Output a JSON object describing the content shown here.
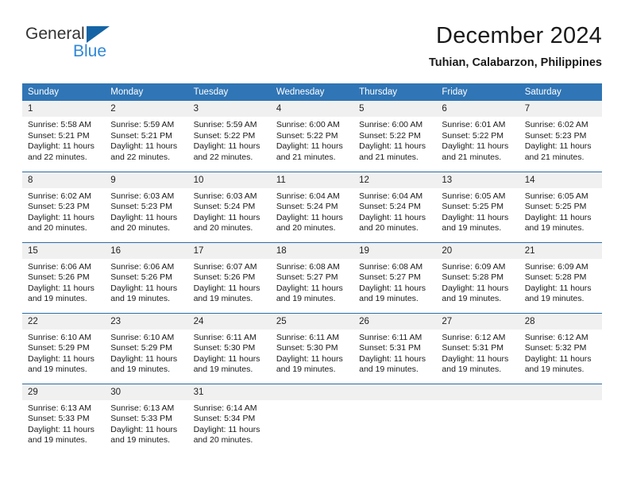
{
  "brand": {
    "name_top": "General",
    "name_bottom": "Blue",
    "triangle_color": "#1464a5",
    "blue_text_color": "#2f87d8"
  },
  "header": {
    "title": "December 2024",
    "subtitle": "Tuhian, Calabarzon, Philippines",
    "accent_color": "#3075b5",
    "row_divider_color": "#2e6da4",
    "daynum_bg": "#f0f0f0"
  },
  "weekday_headers": [
    "Sunday",
    "Monday",
    "Tuesday",
    "Wednesday",
    "Thursday",
    "Friday",
    "Saturday"
  ],
  "weeks": [
    [
      {
        "day": "1",
        "sunrise": "Sunrise: 5:58 AM",
        "sunset": "Sunset: 5:21 PM",
        "daylight_line1": "Daylight: 11 hours",
        "daylight_line2": "and 22 minutes."
      },
      {
        "day": "2",
        "sunrise": "Sunrise: 5:59 AM",
        "sunset": "Sunset: 5:21 PM",
        "daylight_line1": "Daylight: 11 hours",
        "daylight_line2": "and 22 minutes."
      },
      {
        "day": "3",
        "sunrise": "Sunrise: 5:59 AM",
        "sunset": "Sunset: 5:22 PM",
        "daylight_line1": "Daylight: 11 hours",
        "daylight_line2": "and 22 minutes."
      },
      {
        "day": "4",
        "sunrise": "Sunrise: 6:00 AM",
        "sunset": "Sunset: 5:22 PM",
        "daylight_line1": "Daylight: 11 hours",
        "daylight_line2": "and 21 minutes."
      },
      {
        "day": "5",
        "sunrise": "Sunrise: 6:00 AM",
        "sunset": "Sunset: 5:22 PM",
        "daylight_line1": "Daylight: 11 hours",
        "daylight_line2": "and 21 minutes."
      },
      {
        "day": "6",
        "sunrise": "Sunrise: 6:01 AM",
        "sunset": "Sunset: 5:22 PM",
        "daylight_line1": "Daylight: 11 hours",
        "daylight_line2": "and 21 minutes."
      },
      {
        "day": "7",
        "sunrise": "Sunrise: 6:02 AM",
        "sunset": "Sunset: 5:23 PM",
        "daylight_line1": "Daylight: 11 hours",
        "daylight_line2": "and 21 minutes."
      }
    ],
    [
      {
        "day": "8",
        "sunrise": "Sunrise: 6:02 AM",
        "sunset": "Sunset: 5:23 PM",
        "daylight_line1": "Daylight: 11 hours",
        "daylight_line2": "and 20 minutes."
      },
      {
        "day": "9",
        "sunrise": "Sunrise: 6:03 AM",
        "sunset": "Sunset: 5:23 PM",
        "daylight_line1": "Daylight: 11 hours",
        "daylight_line2": "and 20 minutes."
      },
      {
        "day": "10",
        "sunrise": "Sunrise: 6:03 AM",
        "sunset": "Sunset: 5:24 PM",
        "daylight_line1": "Daylight: 11 hours",
        "daylight_line2": "and 20 minutes."
      },
      {
        "day": "11",
        "sunrise": "Sunrise: 6:04 AM",
        "sunset": "Sunset: 5:24 PM",
        "daylight_line1": "Daylight: 11 hours",
        "daylight_line2": "and 20 minutes."
      },
      {
        "day": "12",
        "sunrise": "Sunrise: 6:04 AM",
        "sunset": "Sunset: 5:24 PM",
        "daylight_line1": "Daylight: 11 hours",
        "daylight_line2": "and 20 minutes."
      },
      {
        "day": "13",
        "sunrise": "Sunrise: 6:05 AM",
        "sunset": "Sunset: 5:25 PM",
        "daylight_line1": "Daylight: 11 hours",
        "daylight_line2": "and 19 minutes."
      },
      {
        "day": "14",
        "sunrise": "Sunrise: 6:05 AM",
        "sunset": "Sunset: 5:25 PM",
        "daylight_line1": "Daylight: 11 hours",
        "daylight_line2": "and 19 minutes."
      }
    ],
    [
      {
        "day": "15",
        "sunrise": "Sunrise: 6:06 AM",
        "sunset": "Sunset: 5:26 PM",
        "daylight_line1": "Daylight: 11 hours",
        "daylight_line2": "and 19 minutes."
      },
      {
        "day": "16",
        "sunrise": "Sunrise: 6:06 AM",
        "sunset": "Sunset: 5:26 PM",
        "daylight_line1": "Daylight: 11 hours",
        "daylight_line2": "and 19 minutes."
      },
      {
        "day": "17",
        "sunrise": "Sunrise: 6:07 AM",
        "sunset": "Sunset: 5:26 PM",
        "daylight_line1": "Daylight: 11 hours",
        "daylight_line2": "and 19 minutes."
      },
      {
        "day": "18",
        "sunrise": "Sunrise: 6:08 AM",
        "sunset": "Sunset: 5:27 PM",
        "daylight_line1": "Daylight: 11 hours",
        "daylight_line2": "and 19 minutes."
      },
      {
        "day": "19",
        "sunrise": "Sunrise: 6:08 AM",
        "sunset": "Sunset: 5:27 PM",
        "daylight_line1": "Daylight: 11 hours",
        "daylight_line2": "and 19 minutes."
      },
      {
        "day": "20",
        "sunrise": "Sunrise: 6:09 AM",
        "sunset": "Sunset: 5:28 PM",
        "daylight_line1": "Daylight: 11 hours",
        "daylight_line2": "and 19 minutes."
      },
      {
        "day": "21",
        "sunrise": "Sunrise: 6:09 AM",
        "sunset": "Sunset: 5:28 PM",
        "daylight_line1": "Daylight: 11 hours",
        "daylight_line2": "and 19 minutes."
      }
    ],
    [
      {
        "day": "22",
        "sunrise": "Sunrise: 6:10 AM",
        "sunset": "Sunset: 5:29 PM",
        "daylight_line1": "Daylight: 11 hours",
        "daylight_line2": "and 19 minutes."
      },
      {
        "day": "23",
        "sunrise": "Sunrise: 6:10 AM",
        "sunset": "Sunset: 5:29 PM",
        "daylight_line1": "Daylight: 11 hours",
        "daylight_line2": "and 19 minutes."
      },
      {
        "day": "24",
        "sunrise": "Sunrise: 6:11 AM",
        "sunset": "Sunset: 5:30 PM",
        "daylight_line1": "Daylight: 11 hours",
        "daylight_line2": "and 19 minutes."
      },
      {
        "day": "25",
        "sunrise": "Sunrise: 6:11 AM",
        "sunset": "Sunset: 5:30 PM",
        "daylight_line1": "Daylight: 11 hours",
        "daylight_line2": "and 19 minutes."
      },
      {
        "day": "26",
        "sunrise": "Sunrise: 6:11 AM",
        "sunset": "Sunset: 5:31 PM",
        "daylight_line1": "Daylight: 11 hours",
        "daylight_line2": "and 19 minutes."
      },
      {
        "day": "27",
        "sunrise": "Sunrise: 6:12 AM",
        "sunset": "Sunset: 5:31 PM",
        "daylight_line1": "Daylight: 11 hours",
        "daylight_line2": "and 19 minutes."
      },
      {
        "day": "28",
        "sunrise": "Sunrise: 6:12 AM",
        "sunset": "Sunset: 5:32 PM",
        "daylight_line1": "Daylight: 11 hours",
        "daylight_line2": "and 19 minutes."
      }
    ],
    [
      {
        "day": "29",
        "sunrise": "Sunrise: 6:13 AM",
        "sunset": "Sunset: 5:33 PM",
        "daylight_line1": "Daylight: 11 hours",
        "daylight_line2": "and 19 minutes."
      },
      {
        "day": "30",
        "sunrise": "Sunrise: 6:13 AM",
        "sunset": "Sunset: 5:33 PM",
        "daylight_line1": "Daylight: 11 hours",
        "daylight_line2": "and 19 minutes."
      },
      {
        "day": "31",
        "sunrise": "Sunrise: 6:14 AM",
        "sunset": "Sunset: 5:34 PM",
        "daylight_line1": "Daylight: 11 hours",
        "daylight_line2": "and 20 minutes."
      },
      {
        "day": "",
        "sunrise": "",
        "sunset": "",
        "daylight_line1": "",
        "daylight_line2": ""
      },
      {
        "day": "",
        "sunrise": "",
        "sunset": "",
        "daylight_line1": "",
        "daylight_line2": ""
      },
      {
        "day": "",
        "sunrise": "",
        "sunset": "",
        "daylight_line1": "",
        "daylight_line2": ""
      },
      {
        "day": "",
        "sunrise": "",
        "sunset": "",
        "daylight_line1": "",
        "daylight_line2": ""
      }
    ]
  ]
}
